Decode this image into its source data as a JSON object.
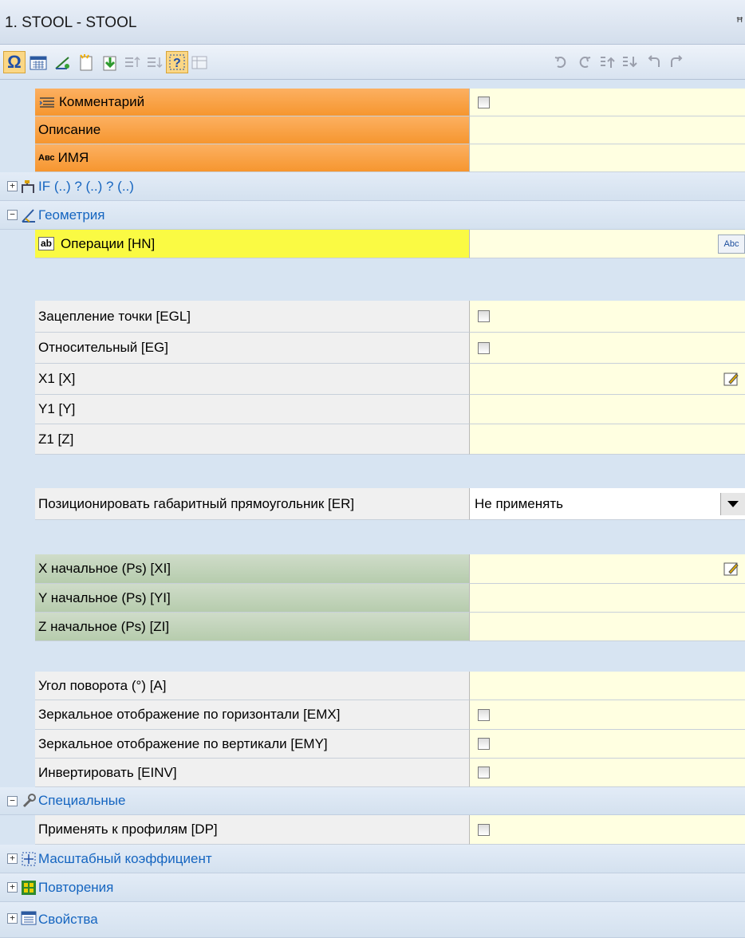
{
  "window": {
    "title": "1. STOOL - STOOL",
    "pin_glyph": "ꟸ"
  },
  "toolbar": {
    "left_icons": [
      "omega-icon",
      "calendar-icon",
      "geometry-icon",
      "new-icon",
      "import-icon",
      "move-up-icon",
      "move-down-icon",
      "help-icon",
      "table-icon"
    ],
    "right_icons": [
      "undo-icon",
      "redo-icon",
      "step-up-icon",
      "step-down-icon",
      "back-icon",
      "forward-icon"
    ]
  },
  "rows": {
    "comment": {
      "label": "Комментарий"
    },
    "description": {
      "label": "Описание"
    },
    "name": {
      "label": "ИМЯ",
      "prefix": "Авс"
    },
    "if_group": {
      "label": "IF (..) ? (..) ? (..)"
    },
    "geometry_group": {
      "label": "Геометрия"
    },
    "operations": {
      "label": "Операции [HN]",
      "prefix": "ab",
      "button": "Abc"
    },
    "egl": {
      "label": "Зацепление точки [EGL]"
    },
    "eg": {
      "label": "Относительный [EG]"
    },
    "x1": {
      "label": "X1 [X]"
    },
    "y1": {
      "label": "Y1 [Y]"
    },
    "z1": {
      "label": "Z1 [Z]"
    },
    "er": {
      "label": "Позиционировать габаритный прямоугольник [ER]",
      "value": "Не применять"
    },
    "xi": {
      "label": "X начальное (Ps) [XI]"
    },
    "yi": {
      "label": "Y начальное (Ps) [YI]"
    },
    "zi": {
      "label": "Z начальное (Ps) [ZI]"
    },
    "angle": {
      "label": "Угол поворота (°) [A]"
    },
    "emx": {
      "label": "Зеркальное отображение по горизонтали [EMX]"
    },
    "emy": {
      "label": "Зеркальное отображение по вертикали [EMY]"
    },
    "einv": {
      "label": "Инвертировать [EINV]"
    },
    "special_group": {
      "label": "Специальные"
    },
    "dp": {
      "label": "Применять к профилям [DP]"
    },
    "scale_group": {
      "label": "Масштабный коэффициент"
    },
    "repeat_group": {
      "label": "Повторения"
    },
    "props_group": {
      "label": "Свойства"
    }
  },
  "colors": {
    "value_bg": "#ffffe1",
    "orange": "#f6962f",
    "yellow": "#fafa43",
    "green": "#b6ccad",
    "group_text": "#1565c0"
  }
}
